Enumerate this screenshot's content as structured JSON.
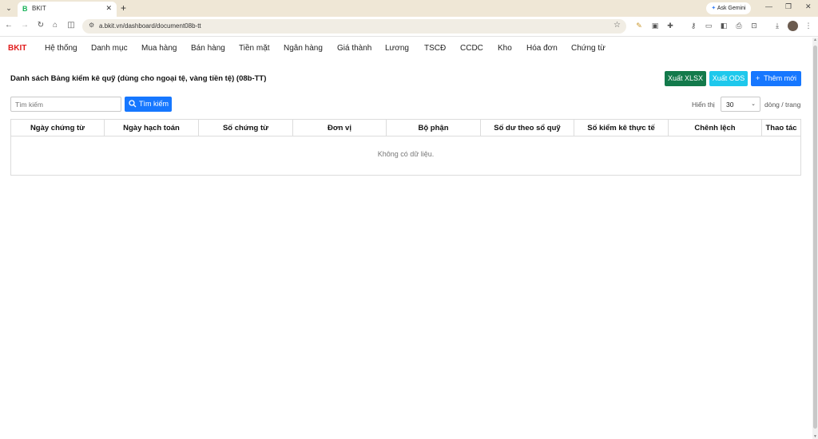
{
  "browser": {
    "tab_title": "BKIT",
    "tab_favicon": "B",
    "new_tab": "+",
    "gemini_label": "Ask Gemini",
    "url": "a.bkit.vn/dashboard/document08b-tt"
  },
  "app": {
    "brand": "BKIT",
    "menu": [
      "Hệ thống",
      "Danh mục",
      "Mua hàng",
      "Bán hàng",
      "Tiền mặt",
      "Ngân hàng",
      "Giá thành",
      "Lương",
      "TSCĐ",
      "CCDC",
      "Kho",
      "Hóa đơn",
      "Chứng từ"
    ]
  },
  "page": {
    "title": "Danh sách Bảng kiểm kê quỹ (dùng cho ngoại tệ, vàng tiền tệ) (08b-TT)",
    "export_xlsx": "Xuất XLSX",
    "export_ods": "Xuất ODS",
    "add_new": "Thêm mới",
    "add_icon": "+",
    "search_placeholder": "Tìm kiếm",
    "search_button": "Tìm kiếm",
    "show_label": "Hiển thị",
    "page_size": "30",
    "per_page_label": "dòng / trang"
  },
  "table": {
    "columns": [
      "Ngày chứng từ",
      "Ngày hạch toán",
      "Số chứng từ",
      "Đơn vị",
      "Bộ phận",
      "Số dư theo sổ quỹ",
      "Số kiểm kê thực tế",
      "Chênh lệch",
      "Thao tác"
    ],
    "empty_text": "Không có dữ liệu."
  },
  "colors": {
    "brand": "#e11d1d",
    "xlsx": "#137a4b",
    "ods": "#1ec8ec",
    "primary": "#1677ff"
  }
}
